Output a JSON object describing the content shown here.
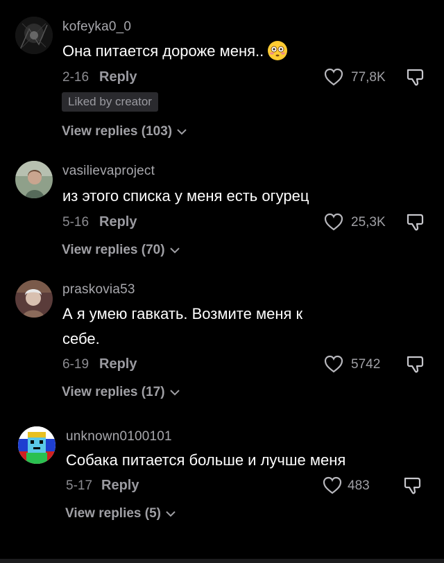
{
  "comments": [
    {
      "username": "kofeyka0_0",
      "text": "Она питается дороже меня..",
      "emoji": "flushed-face",
      "date": "2-16",
      "reply_label": "Reply",
      "likes": "77,8K",
      "badge": "Liked by creator",
      "view_replies": "View replies (103)"
    },
    {
      "username": "vasilievaproject",
      "text": "из этого списка у меня есть огурец",
      "date": "5-16",
      "reply_label": "Reply",
      "likes": "25,3K",
      "view_replies": "View replies (70)"
    },
    {
      "username": "praskovia53",
      "text_line1": "А я умею гавкать. Возмите меня к",
      "text_line2": "себе.",
      "date": "6-19",
      "reply_label": "Reply",
      "likes": "5742",
      "view_replies": "View replies (17)"
    },
    {
      "username": "unknown0100101",
      "text": "Собака питается больше и лучше меня",
      "date": "5-17",
      "reply_label": "Reply",
      "likes": "483",
      "view_replies": "View replies (5)"
    }
  ],
  "colors": {
    "background": "#000000",
    "username": "#a8a8ad",
    "secondary_text": "#8c8c91",
    "badge_bg": "#2a2a2e"
  }
}
